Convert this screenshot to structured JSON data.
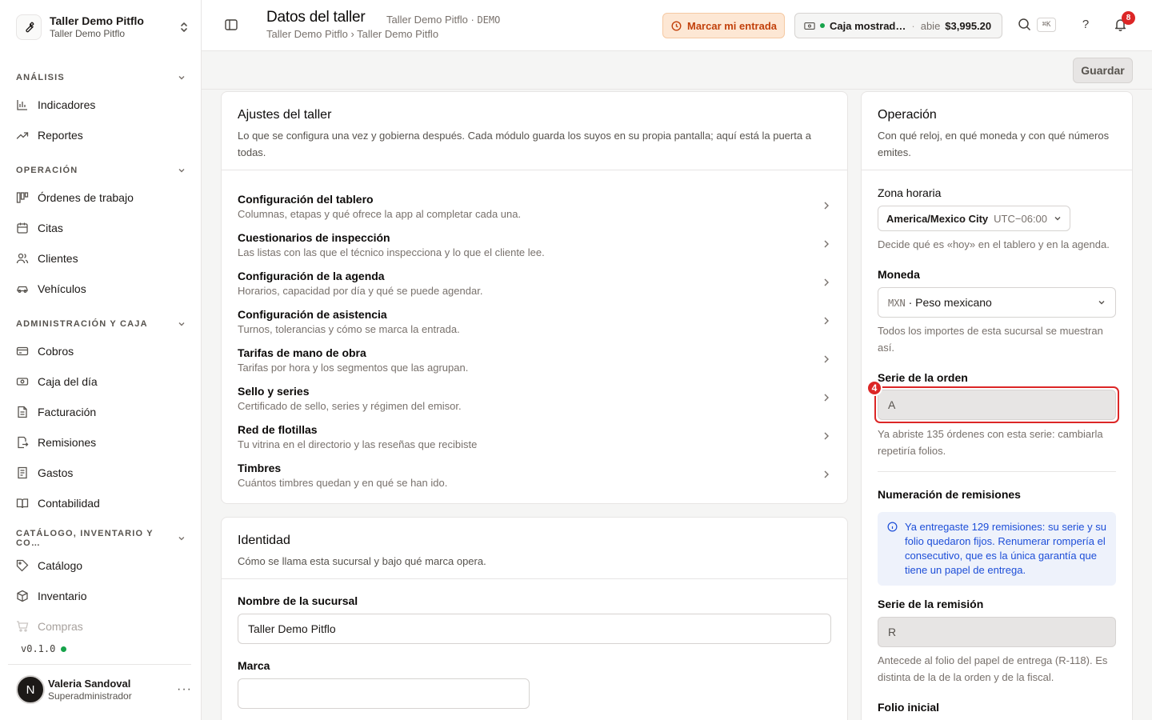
{
  "workspace": {
    "name": "Taller Demo Pitflo",
    "sub": "Taller Demo Pitflo"
  },
  "sidebar": {
    "sections": [
      {
        "label": "ANÁLISIS"
      },
      {
        "label": "OPERACIÓN"
      },
      {
        "label": "ADMINISTRACIÓN Y CAJA"
      },
      {
        "label": "CATÁLOGO, INVENTARIO Y CO…"
      }
    ],
    "items": [
      {
        "label": "Indicadores",
        "icon": "bar-chart-icon"
      },
      {
        "label": "Reportes",
        "icon": "trend-icon"
      },
      {
        "label": "Órdenes de trabajo",
        "icon": "kanban-icon"
      },
      {
        "label": "Citas",
        "icon": "calendar-icon"
      },
      {
        "label": "Clientes",
        "icon": "users-icon"
      },
      {
        "label": "Vehículos",
        "icon": "car-icon"
      },
      {
        "label": "Cobros",
        "icon": "credit-card-icon"
      },
      {
        "label": "Caja del día",
        "icon": "cash-icon"
      },
      {
        "label": "Facturación",
        "icon": "invoice-icon"
      },
      {
        "label": "Remisiones",
        "icon": "file-out-icon"
      },
      {
        "label": "Gastos",
        "icon": "receipt-icon"
      },
      {
        "label": "Contabilidad",
        "icon": "book-icon"
      },
      {
        "label": "Catálogo",
        "icon": "tag-icon"
      },
      {
        "label": "Inventario",
        "icon": "box-icon"
      },
      {
        "label": "Compras",
        "icon": "cart-icon"
      }
    ],
    "version": "v0.1.0"
  },
  "user": {
    "initial": "N",
    "name": "Valeria Sandoval",
    "role": "Superadministrador"
  },
  "header": {
    "title": "Datos del taller",
    "meta_name": "Taller Demo Pitflo ·",
    "meta_tag": "DEMO",
    "breadcrumb": "Taller Demo Pitflo › Taller Demo Pitflo",
    "clock_in_label": "Marcar mi entrada",
    "cash": {
      "name": "Caja mostrad…",
      "sep": "·",
      "status": "abie",
      "amount": "$3,995.20"
    },
    "kbd": "⌘K",
    "help": "?",
    "notifications": "8"
  },
  "toolbar": {
    "save_label": "Guardar"
  },
  "settings_card": {
    "title": "Ajustes del taller",
    "desc": "Lo que se configura una vez y gobierna después. Cada módulo guarda los suyos en su propia pantalla; aquí está la puerta a todas.",
    "rows": [
      {
        "title": "Configuración del tablero",
        "desc": "Columnas, etapas y qué ofrece la app al completar cada una."
      },
      {
        "title": "Cuestionarios de inspección",
        "desc": "Las listas con las que el técnico inspecciona y lo que el cliente lee."
      },
      {
        "title": "Configuración de la agenda",
        "desc": "Horarios, capacidad por día y qué se puede agendar."
      },
      {
        "title": "Configuración de asistencia",
        "desc": "Turnos, tolerancias y cómo se marca la entrada."
      },
      {
        "title": "Tarifas de mano de obra",
        "desc": "Tarifas por hora y los segmentos que las agrupan."
      },
      {
        "title": "Sello y series",
        "desc": "Certificado de sello, series y régimen del emisor."
      },
      {
        "title": "Red de flotillas",
        "desc": "Tu vitrina en el directorio y las reseñas que recibiste"
      },
      {
        "title": "Timbres",
        "desc": "Cuántos timbres quedan y en qué se han ido."
      }
    ]
  },
  "identity_card": {
    "title": "Identidad",
    "desc": "Cómo se llama esta sucursal y bajo qué marca opera.",
    "branch_label": "Nombre de la sucursal",
    "branch_value": "Taller Demo Pitflo",
    "brand_label": "Marca",
    "brand_value": ""
  },
  "operation_card": {
    "title": "Operación",
    "desc": "Con qué reloj, en qué moneda y con qué números emites.",
    "tz_label": "Zona horaria",
    "tz_name": "America/Mexico City",
    "tz_offset": "UTC−06:00",
    "tz_hint": "Decide qué es «hoy» en el tablero y en la agenda.",
    "currency_label": "Moneda",
    "currency_code": "MXN",
    "currency_name": "· Peso mexicano",
    "currency_hint": "Todos los importes de esta sucursal se muestran así.",
    "order_series_label": "Serie de la orden",
    "order_series_value": "A",
    "order_series_hint": "Ya abriste 135 órdenes con esta serie: cambiarla repetiría folios.",
    "marker": "4",
    "remission_numbering_label": "Numeración de remisiones",
    "remission_info": "Ya entregaste 129 remisiones: su serie y su folio quedaron fijos. Renumerar rompería el consecutivo, que es la única garantía que tiene un papel de entrega.",
    "remission_series_label": "Serie de la remisión",
    "remission_series_value": "R",
    "remission_series_hint": "Antecede al folio del papel de entrega (R-118). Es distinta de la de la orden y de la fiscal.",
    "initial_folio_label": "Folio inicial"
  },
  "colors": {
    "accent_warning": "#c2410c",
    "danger": "#dc2626",
    "info": "#1d4ed8",
    "success": "#16a34a"
  }
}
